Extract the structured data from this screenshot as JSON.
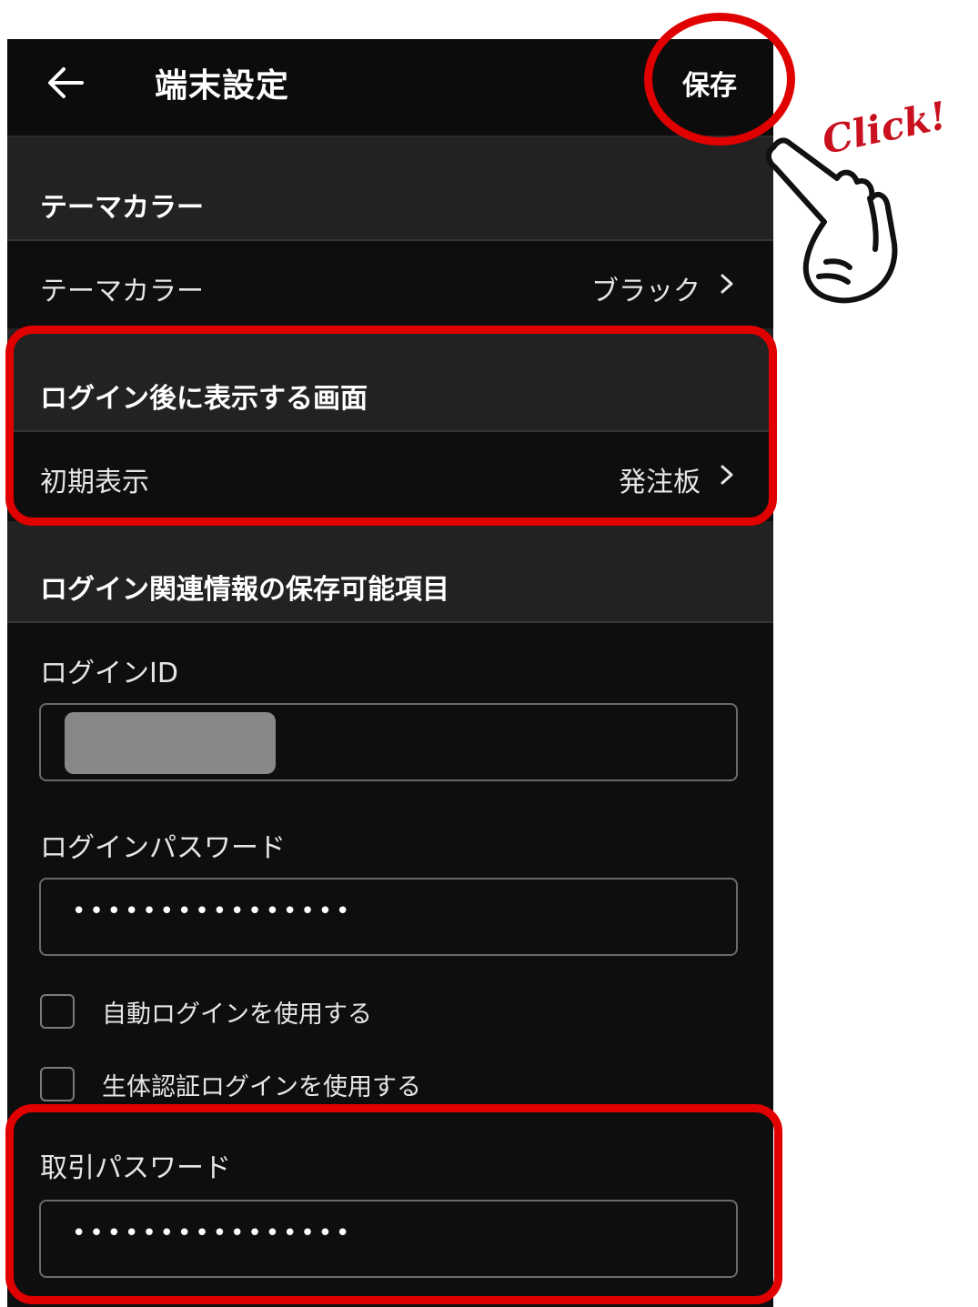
{
  "app_bar": {
    "title": "端末設定",
    "save_label": "保存"
  },
  "theme": {
    "section_title": "テーマカラー",
    "row_label": "テーマカラー",
    "row_value": "ブラック"
  },
  "after_login": {
    "section_title": "ログイン後に表示する画面",
    "row_label": "初期表示",
    "row_value": "発注板"
  },
  "login_info": {
    "section_title": "ログイン関連情報の保存可能項目",
    "login_id_label": "ログインID",
    "login_password_label": "ログインパスワード",
    "login_password_value": "••••••••••••••••",
    "auto_login_label": "自動ログインを使用する",
    "bio_login_label": "生体認証ログインを使用する",
    "trade_password_label": "取引パスワード",
    "trade_password_value": "••••••••••••••••"
  },
  "annotation": {
    "click_text": "Click!",
    "highlight_color": "#e00000"
  },
  "icons": {
    "back": "arrow-left-icon",
    "chevron": "chevron-right-icon",
    "hand": "pointing-hand-icon"
  }
}
